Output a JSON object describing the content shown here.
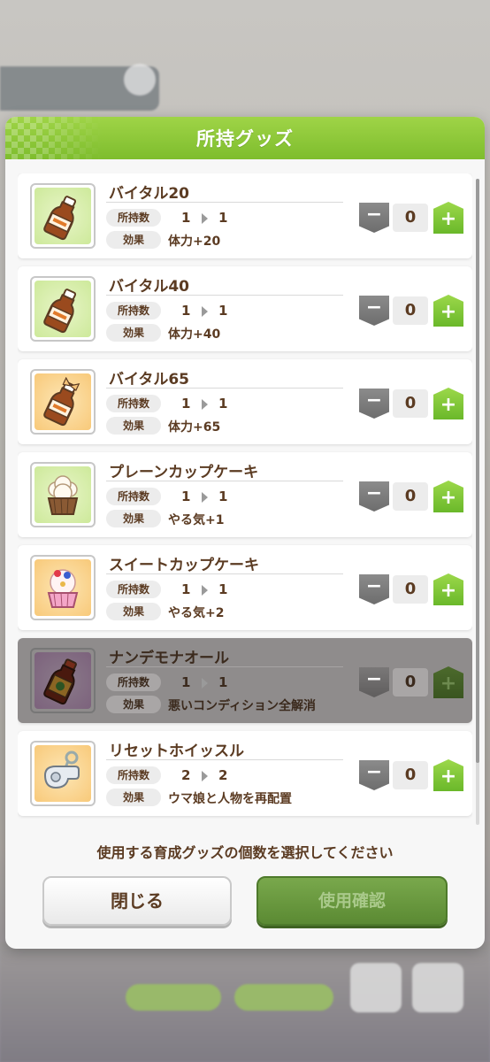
{
  "dialog": {
    "title": "所持グッズ",
    "instruction": "使用する育成グッズの個数を選択してください",
    "close_label": "閉じる",
    "confirm_label": "使用確認"
  },
  "labels": {
    "owned": "所持数",
    "effect": "効果",
    "minus": "−",
    "plus": "+"
  },
  "items": [
    {
      "name": "バイタル20",
      "owned_from": "1",
      "owned_to": "1",
      "effect": "体力+20",
      "count": "0",
      "icon": "brown-bottle-icon",
      "bg": "green",
      "disabled": false
    },
    {
      "name": "バイタル40",
      "owned_from": "1",
      "owned_to": "1",
      "effect": "体力+40",
      "count": "0",
      "icon": "brown-bottle-icon",
      "bg": "green",
      "disabled": false
    },
    {
      "name": "バイタル65",
      "owned_from": "1",
      "owned_to": "1",
      "effect": "体力+65",
      "count": "0",
      "icon": "brown-bottle-ribbon-icon",
      "bg": "orange",
      "disabled": false
    },
    {
      "name": "プレーンカップケーキ",
      "owned_from": "1",
      "owned_to": "1",
      "effect": "やる気+1",
      "count": "0",
      "icon": "cupcake-icon",
      "bg": "green",
      "disabled": false
    },
    {
      "name": "スイートカップケーキ",
      "owned_from": "1",
      "owned_to": "1",
      "effect": "やる気+2",
      "count": "0",
      "icon": "sweet-cupcake-icon",
      "bg": "orange",
      "disabled": false
    },
    {
      "name": "ナンデモナオール",
      "owned_from": "1",
      "owned_to": "1",
      "effect": "悪いコンディション全解消",
      "count": "0",
      "icon": "medicine-bottle-icon",
      "bg": "purple",
      "disabled": true
    },
    {
      "name": "リセットホイッスル",
      "owned_from": "2",
      "owned_to": "2",
      "effect": "ウマ娘と人物を再配置",
      "count": "0",
      "icon": "whistle-icon",
      "bg": "orange",
      "disabled": false
    }
  ]
}
